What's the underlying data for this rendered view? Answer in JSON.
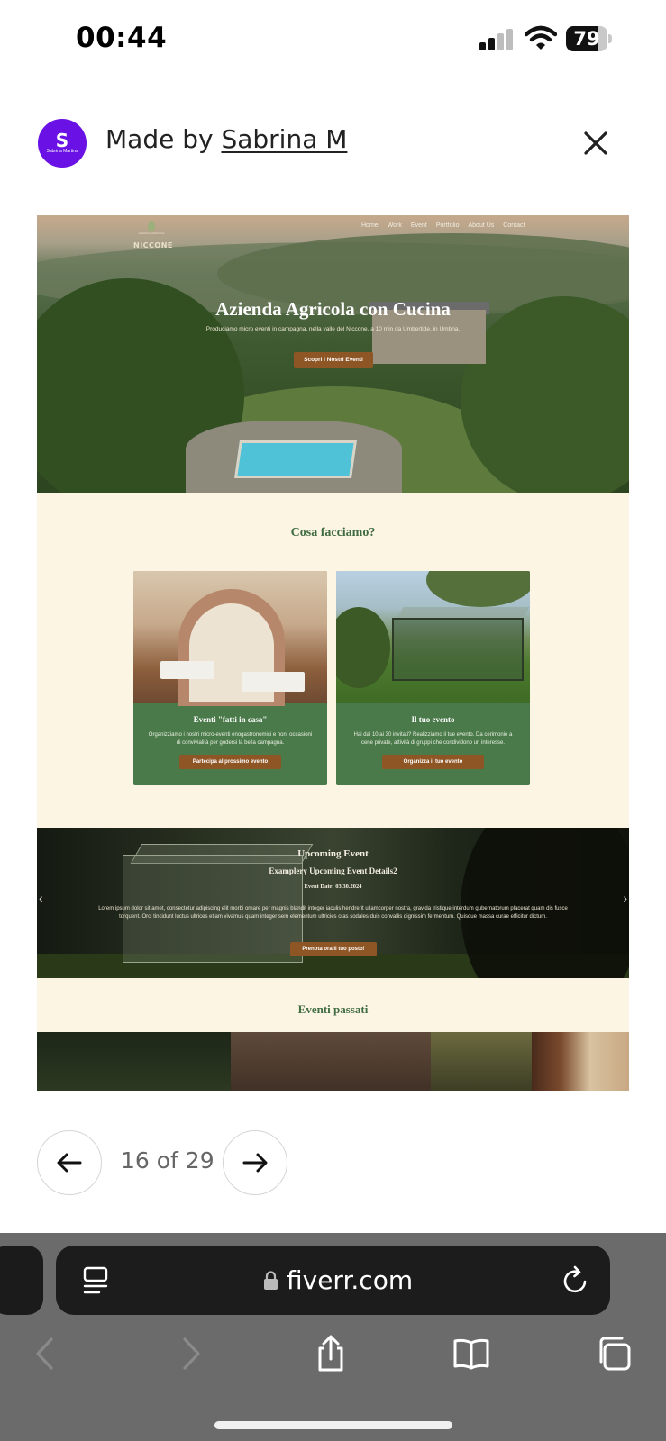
{
  "status_bar": {
    "time": "00:44",
    "battery": "79",
    "battery_level": 0.79
  },
  "header": {
    "avatar_mark": "S",
    "avatar_text": "Sabrina Martins",
    "made_by": "Made by",
    "author": "Sabrina M"
  },
  "site": {
    "logo_tiny": "AZIENDA AGRICOLA",
    "logo_name": "NICCONE",
    "nav": [
      "Home",
      "Work",
      "Event",
      "Portfolio",
      "About Us",
      "Contact"
    ],
    "hero_title": "Azienda Agricola con Cucina",
    "hero_subtitle": "Produciamo micro eventi in campagna, nella valle del Niccone, a 10 min da Umbertide, in Umbria.",
    "hero_button": "Scopri i Nostri Eventi",
    "section_title": "Cosa facciamo?",
    "cards": [
      {
        "title": "Eventi \"fatti in casa\"",
        "text": "Organizziamo i nostri micro-eventi enogastronomici e non: occasioni di convivialità per godersi la bella campagna.",
        "button": "Partecipa al prossimo evento"
      },
      {
        "title": "Il tuo evento",
        "text": "Hai dai 10 ai 30 invitati? Realizziamo il tue evento. Da cerimonie a cene private, attività di gruppi che condividono un interesse.",
        "button": "Organizza il tuo evento"
      }
    ],
    "upcoming": {
      "title": "Upcoming Event",
      "detail": "Examplery Upcoming Event Details2",
      "date": "Event Date: 03.30.2024",
      "lorem": "Lorem ipsum dolor sit amet, consectetur adipiscing elit morbi ornare per magnis blandit integer iaculis hendrerit ullamcorper nostra, gravida tristique interdum gubernatorum placerat quam dis fusce torquent. Orci tincidunt luctus ultrices etiam vivamus quam integer sem elementum ultricies cras sodales duis convallis dignissim fermentum. Quisque massa curae efficitur dictum.",
      "button": "Prenota ora il tuo posto!"
    },
    "past_title": "Eventi passati"
  },
  "pager": {
    "text": "16 of 29"
  },
  "browser": {
    "url": "fiverr.com"
  }
}
